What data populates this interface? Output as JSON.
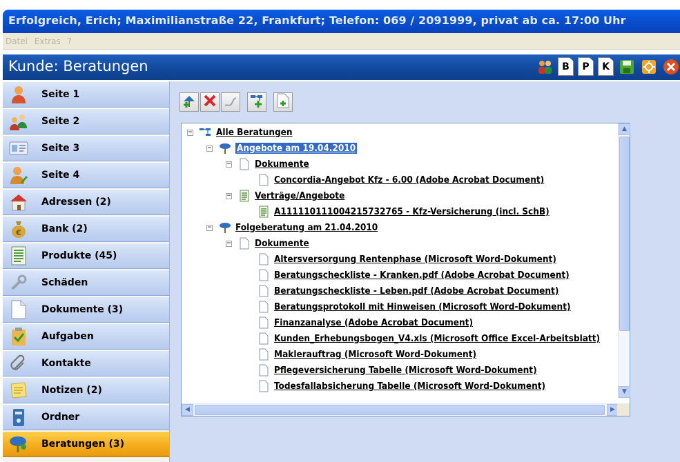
{
  "window": {
    "title": "Erfolgreich, Erich; Maximilianstraße 22, Frankfurt; Telefon: 069 / 2091999, privat ab ca. 17:00 Uhr"
  },
  "menu": [
    "Datei",
    "Extras",
    "?"
  ],
  "header": {
    "title": "Kunde: Beratungen",
    "toolbar": {
      "b_label": "B",
      "p_label": "P",
      "k_label": "K",
      "icons": [
        "people-icon",
        "b-document-icon",
        "p-document-icon",
        "k-document-icon",
        "save-icon",
        "navigate-icon",
        "close-icon"
      ]
    }
  },
  "sidebar": {
    "items": [
      {
        "label": "Seite 1",
        "icon": "person-icon"
      },
      {
        "label": "Seite 2",
        "icon": "group-icon"
      },
      {
        "label": "Seite 3",
        "icon": "id-card-icon"
      },
      {
        "label": "Seite 4",
        "icon": "person-edit-icon"
      },
      {
        "label": "Adressen (2)",
        "icon": "house-icon"
      },
      {
        "label": "Bank (2)",
        "icon": "money-bag-icon"
      },
      {
        "label": "Produkte (45)",
        "icon": "product-list-icon"
      },
      {
        "label": "Schäden",
        "icon": "wrench-icon"
      },
      {
        "label": "Dokumente (3)",
        "icon": "document-icon"
      },
      {
        "label": "Aufgaben",
        "icon": "task-icon"
      },
      {
        "label": "Kontakte",
        "icon": "paperclip-icon"
      },
      {
        "label": "Notizen (2)",
        "icon": "notes-icon"
      },
      {
        "label": "Ordner",
        "icon": "folder-icon"
      },
      {
        "label": "Beratungen (3)",
        "icon": "consultation-icon"
      }
    ],
    "active_index": 13
  },
  "main": {
    "toolbar": [
      "add-consultation-icon",
      "delete-icon",
      "edit-icon",
      "add-node-icon",
      "new-document-icon"
    ],
    "tree": [
      {
        "label": "Alle Beratungen",
        "level": 0,
        "icon": "tree-root-icon",
        "expander": "−"
      },
      {
        "label": "Angebote am 19.04.2010",
        "level": 1,
        "icon": "consultation-icon",
        "expander": "−",
        "selected": true
      },
      {
        "label": "Dokumente",
        "level": 2,
        "icon": "document-icon",
        "expander": "−"
      },
      {
        "label": "Concordia-Angebot Kfz - 6.00 (Adobe Acrobat Document)",
        "level": 3,
        "icon": "document-icon"
      },
      {
        "label": "Verträge/Angebote",
        "level": 2,
        "icon": "contract-icon",
        "expander": "−"
      },
      {
        "label": "A111110111004215732765 - Kfz-Versicherung (incl. SchB)",
        "level": 3,
        "icon": "contract-icon"
      },
      {
        "label": "Folgeberatung am 21.04.2010",
        "level": 1,
        "icon": "consultation-icon",
        "expander": "−"
      },
      {
        "label": "Dokumente",
        "level": 2,
        "icon": "document-icon",
        "expander": "−"
      },
      {
        "label": "Altersversorgung Rentenphase (Microsoft Word-Dokument)",
        "level": 3,
        "icon": "document-icon"
      },
      {
        "label": "Beratungscheckliste - Kranken.pdf (Adobe Acrobat Document)",
        "level": 3,
        "icon": "document-icon"
      },
      {
        "label": "Beratungscheckliste - Leben.pdf (Adobe Acrobat Document)",
        "level": 3,
        "icon": "document-icon"
      },
      {
        "label": "Beratungsprotokoll mit Hinweisen (Microsoft Word-Dokument)",
        "level": 3,
        "icon": "document-icon"
      },
      {
        "label": "Finanzanalyse (Adobe Acrobat Document)",
        "level": 3,
        "icon": "document-icon"
      },
      {
        "label": "Kunden_Erhebungsbogen_V4.xls (Microsoft Office Excel-Arbeitsblatt)",
        "level": 3,
        "icon": "document-icon"
      },
      {
        "label": "Maklerauftrag (Microsoft Word-Dokument)",
        "level": 3,
        "icon": "document-icon"
      },
      {
        "label": "Pflegeversicherung Tabelle (Microsoft Word-Dokument)",
        "level": 3,
        "icon": "document-icon"
      },
      {
        "label": "Todesfallabsicherung Tabelle (Microsoft Word-Dokument)",
        "level": 3,
        "icon": "document-icon"
      }
    ]
  }
}
